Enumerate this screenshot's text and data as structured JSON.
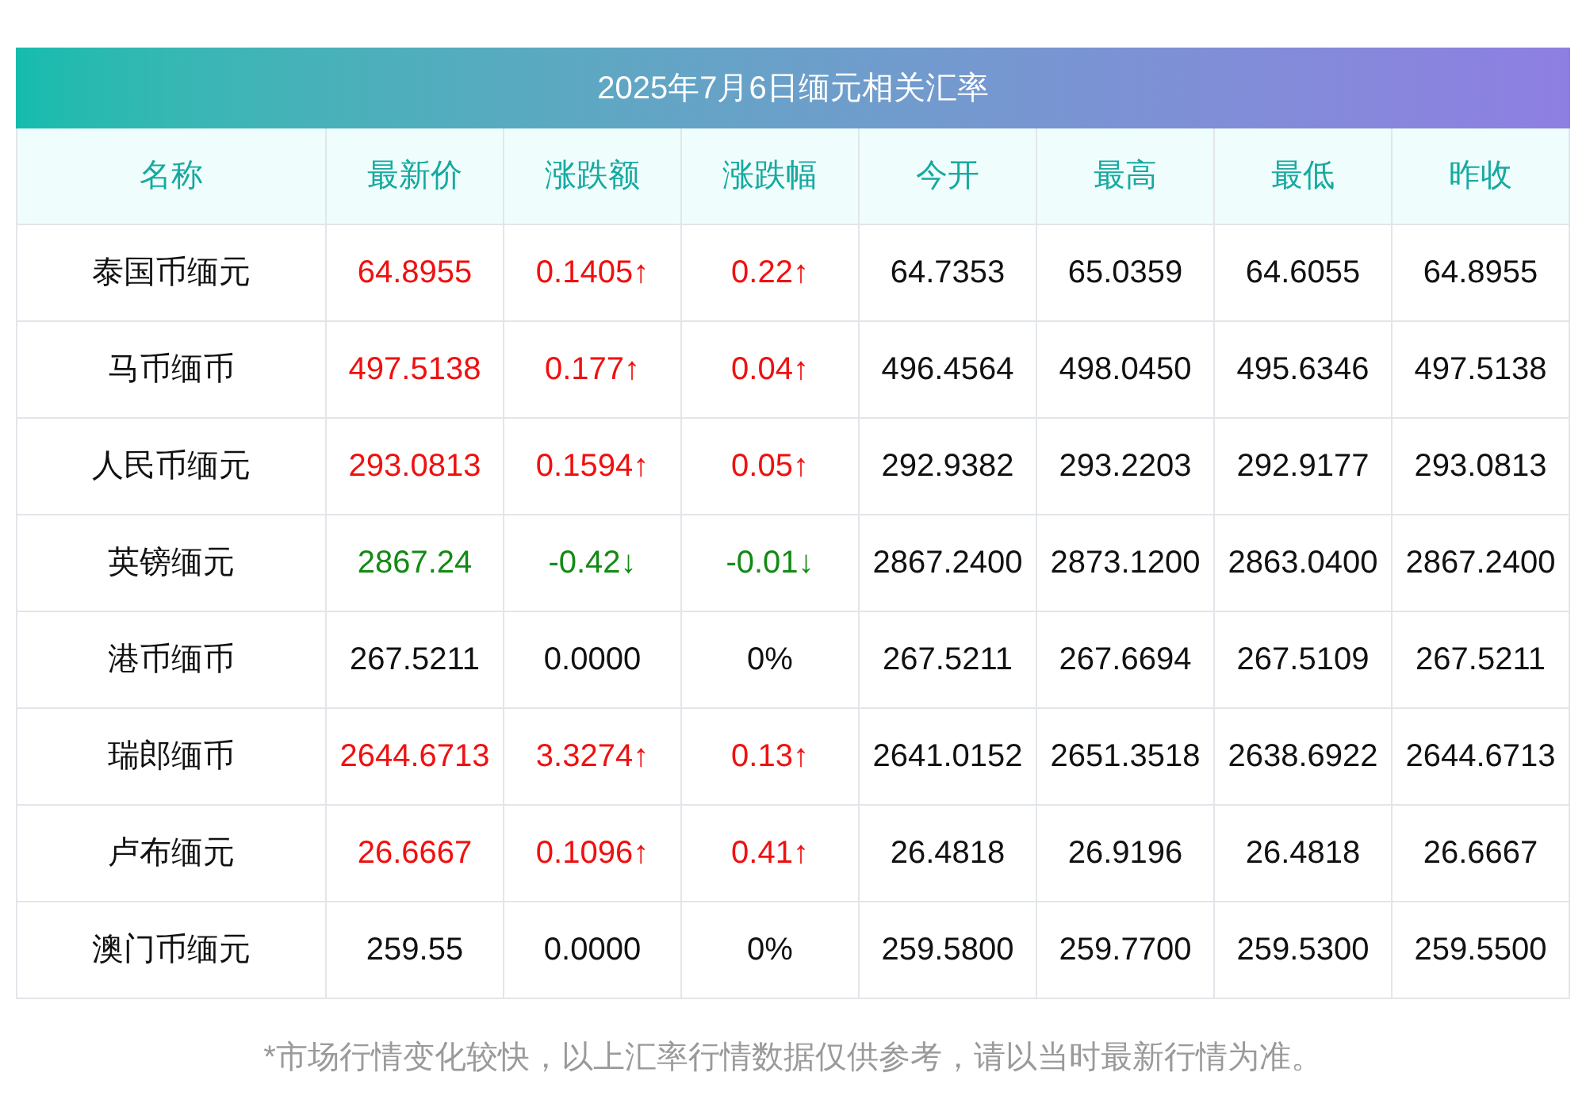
{
  "title": "2025年7月6日缅元相关汇率",
  "columns": [
    "名称",
    "最新价",
    "涨跌额",
    "涨跌幅",
    "今开",
    "最高",
    "最低",
    "昨收"
  ],
  "rows": [
    {
      "color": "#f01010",
      "cells": [
        "泰国币缅元",
        "64.8955",
        "0.1405↑",
        "0.22↑",
        "64.7353",
        "65.0359",
        "64.6055",
        "64.8955"
      ]
    },
    {
      "color": "#f01010",
      "cells": [
        "马币缅币",
        "497.5138",
        "0.177↑",
        "0.04↑",
        "496.4564",
        "498.0450",
        "495.6346",
        "497.5138"
      ]
    },
    {
      "color": "#f01010",
      "cells": [
        "人民币缅元",
        "293.0813",
        "0.1594↑",
        "0.05↑",
        "292.9382",
        "293.2203",
        "292.9177",
        "293.0813"
      ]
    },
    {
      "color": "#138a13",
      "cells": [
        "英镑缅元",
        "2867.24",
        "-0.42↓",
        "-0.01↓",
        "2867.2400",
        "2873.1200",
        "2863.0400",
        "2867.2400"
      ]
    },
    {
      "color": "#111111",
      "cells": [
        "港币缅币",
        "267.5211",
        "0.0000",
        "0%",
        "267.5211",
        "267.6694",
        "267.5109",
        "267.5211"
      ]
    },
    {
      "color": "#f01010",
      "cells": [
        "瑞郎缅币",
        "2644.6713",
        "3.3274↑",
        "0.13↑",
        "2641.0152",
        "2651.3518",
        "2638.6922",
        "2644.6713"
      ]
    },
    {
      "color": "#f01010",
      "cells": [
        "卢布缅元",
        "26.6667",
        "0.1096↑",
        "0.41↑",
        "26.4818",
        "26.9196",
        "26.4818",
        "26.6667"
      ]
    },
    {
      "color": "#111111",
      "cells": [
        "澳门币缅元",
        "259.55",
        "0.0000",
        "0%",
        "259.5800",
        "259.7700",
        "259.5300",
        "259.5500"
      ]
    }
  ],
  "footnote": "*市场行情变化较快，以上汇率行情数据仅供参考，请以当时最新行情为准。"
}
